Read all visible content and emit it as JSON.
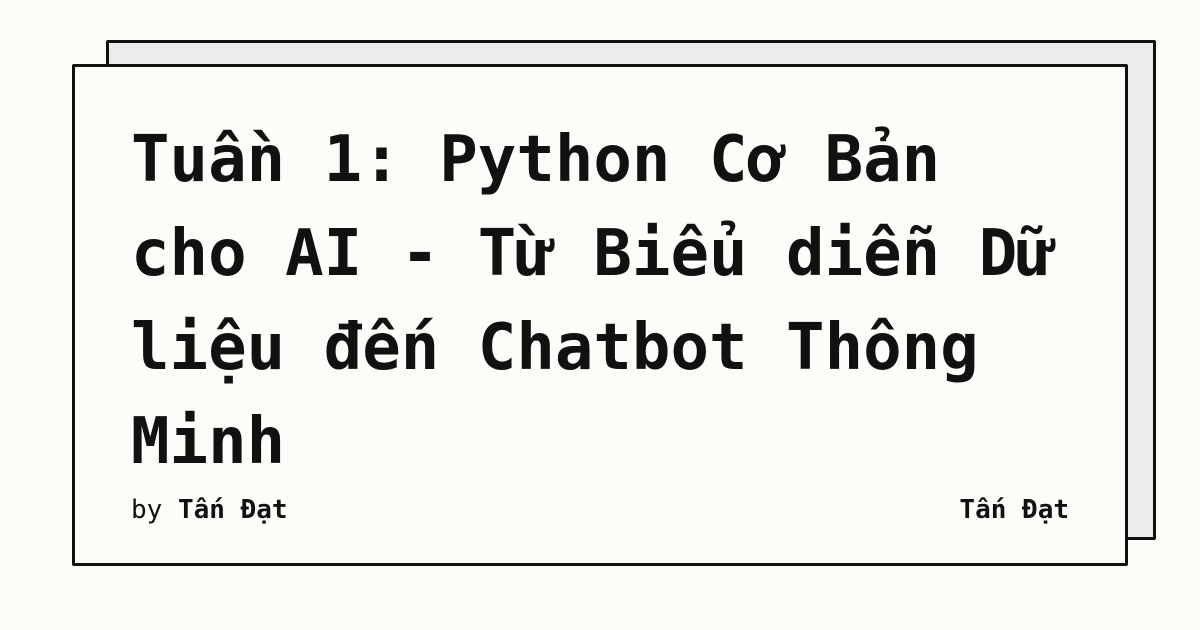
{
  "card": {
    "title": "Tuần 1: Python Cơ Bản cho AI - Từ Biểu diễn Dữ liệu đến Chatbot Thông Minh",
    "byline_prefix": "by",
    "author": "Tấn Đạt",
    "site_name": "Tấn Đạt"
  },
  "colors": {
    "background": "#fcfbf8",
    "card_front": "#fdfcf9",
    "card_back": "#ececec",
    "border": "#111111",
    "text": "#111111"
  }
}
